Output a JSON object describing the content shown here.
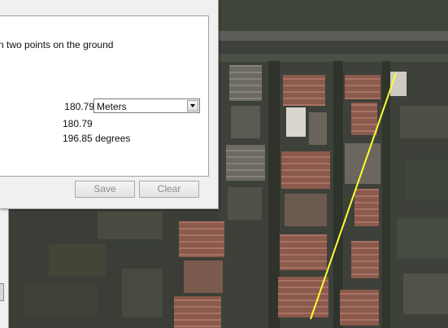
{
  "ruler": {
    "description": "n two points on the ground",
    "length_value": "180.79",
    "units_selected": "Meters",
    "map_length": "180.79",
    "heading": "196.85 degrees",
    "save_label": "Save",
    "clear_label": "Clear"
  },
  "colors": {
    "measure_line": "#ffff33",
    "map_base": "#3c4038"
  }
}
